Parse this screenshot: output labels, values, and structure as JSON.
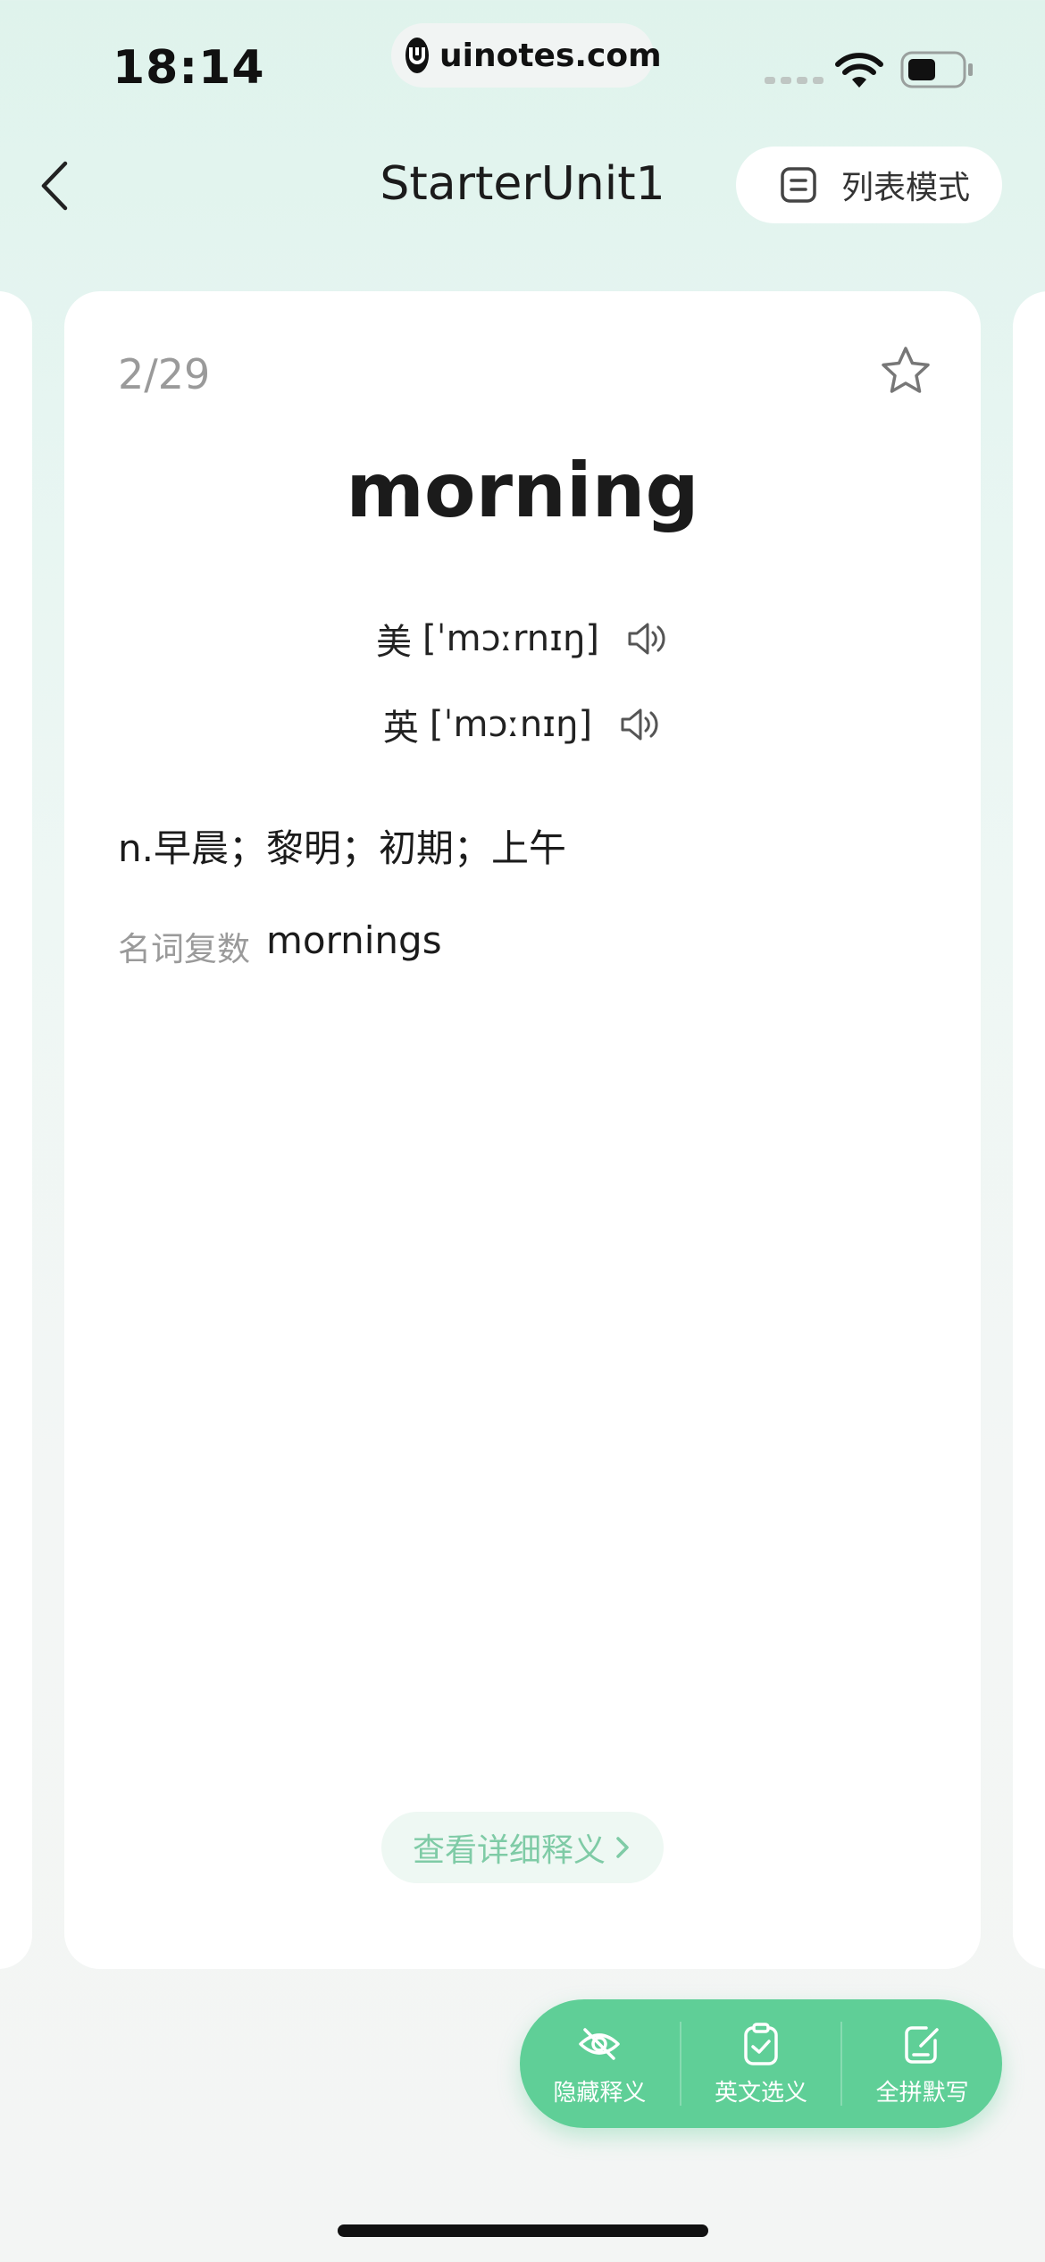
{
  "status_bar": {
    "time": "18:14",
    "url": "uinotes.com"
  },
  "header": {
    "title": "StarterUnit1",
    "list_mode_label": "列表模式"
  },
  "card": {
    "counter": "2/29",
    "word": "morning",
    "phonetics": [
      {
        "tag": "美",
        "ipa": "[ˈmɔːrnɪŋ]"
      },
      {
        "tag": "英",
        "ipa": "[ˈmɔːnɪŋ]"
      }
    ],
    "definition": "n.早晨；黎明；初期；上午",
    "word_form": {
      "label": "名词复数",
      "value": "mornings"
    },
    "detail_button": "查看详细释义"
  },
  "actions": [
    {
      "label": "隐藏释义",
      "icon": "eye-off-icon"
    },
    {
      "label": "英文选义",
      "icon": "clipboard-check-icon"
    },
    {
      "label": "全拼默写",
      "icon": "edit-note-icon"
    }
  ],
  "colors": {
    "accent": "#5fcf97",
    "detail_text": "#7fcba6"
  }
}
